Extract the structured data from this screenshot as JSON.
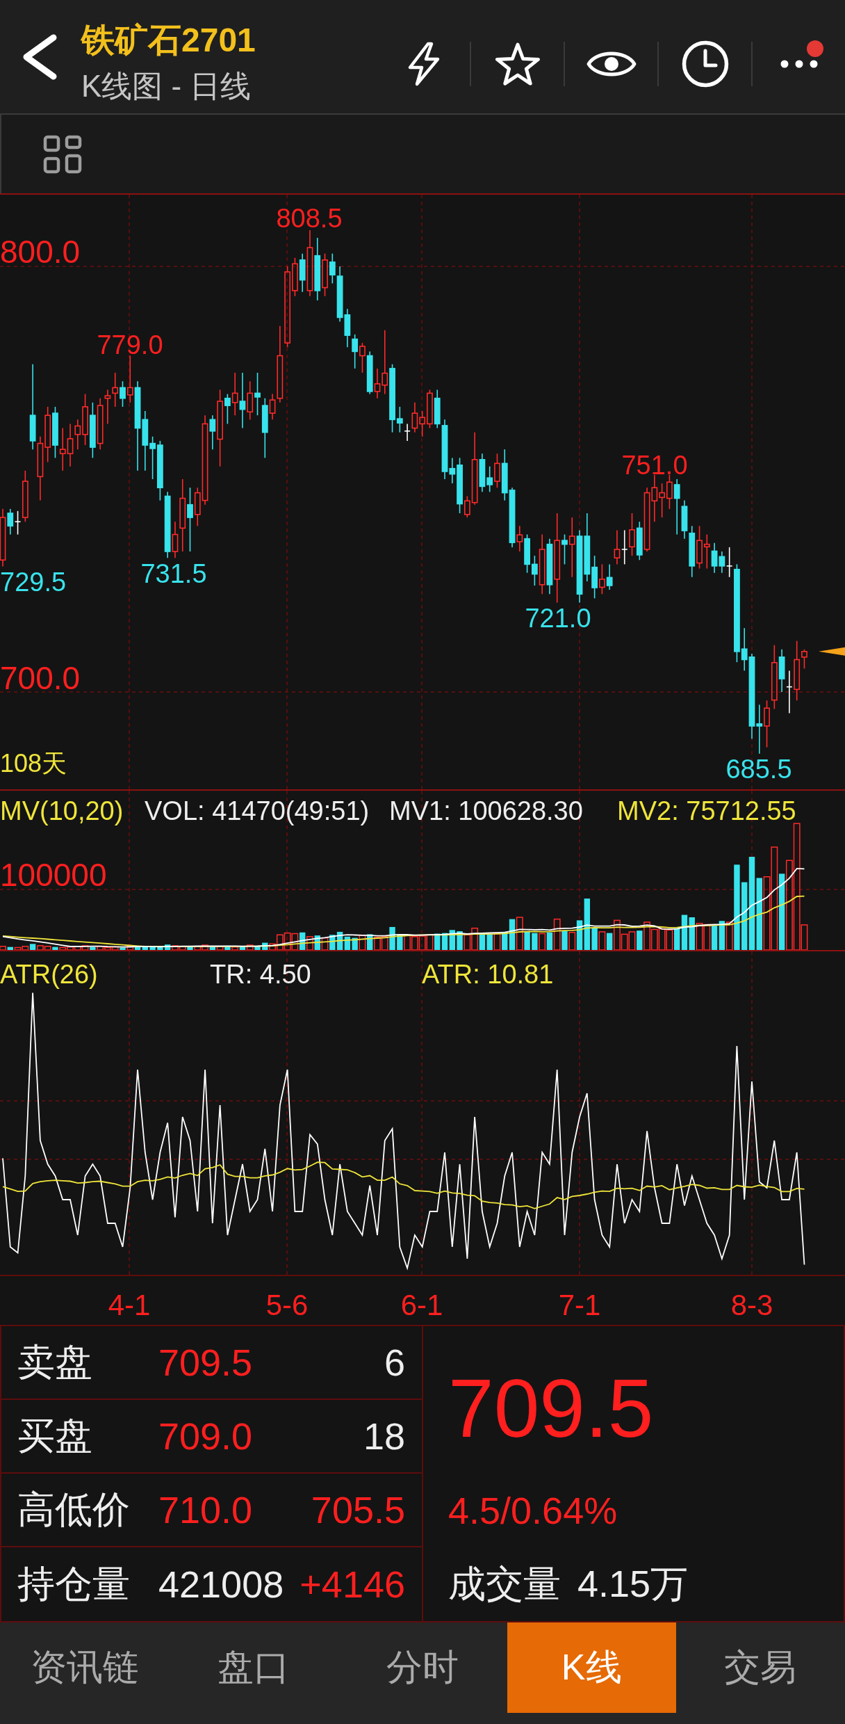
{
  "header": {
    "title": "铁矿石2701",
    "subtitle": "K线图 - 日线",
    "notification_dot": true
  },
  "price_chart": {
    "price_labels": [
      "800.0",
      "700.0"
    ],
    "extreme_labels": [
      {
        "text": "729.5",
        "kind": "low"
      },
      {
        "text": "779.0",
        "kind": "high"
      },
      {
        "text": "731.5",
        "kind": "low"
      },
      {
        "text": "808.5",
        "kind": "high"
      },
      {
        "text": "721.0",
        "kind": "low"
      },
      {
        "text": "751.0",
        "kind": "high"
      },
      {
        "text": "685.5",
        "kind": "low"
      }
    ],
    "day_count": "108天"
  },
  "volume_chart": {
    "legend": [
      {
        "text": "MV(10,20)",
        "kind": "title"
      },
      {
        "text": "VOL: 41470(49:51)",
        "kind": "vol"
      },
      {
        "text": "MV1: 100628.30",
        "kind": "mv1"
      },
      {
        "text": "MV2: 75712.55",
        "kind": "mv2"
      }
    ],
    "scale_label": "100000"
  },
  "atr_chart": {
    "legend": [
      {
        "text": "ATR(26)",
        "kind": "title"
      },
      {
        "text": "TR: 4.50",
        "kind": "tr"
      },
      {
        "text": "ATR: 10.81",
        "kind": "atr"
      }
    ]
  },
  "x_axis": [
    "4-1",
    "5-6",
    "6-1",
    "7-1",
    "8-3"
  ],
  "quote_table": {
    "rows": [
      {
        "label": "卖盘",
        "cells": [
          {
            "text": "709.5",
            "color": "#ff1f1f"
          },
          {
            "text": "6",
            "color": "#eeeeee"
          }
        ]
      },
      {
        "label": "买盘",
        "cells": [
          {
            "text": "709.0",
            "color": "#ff1f1f"
          },
          {
            "text": "18",
            "color": "#eeeeee"
          }
        ]
      },
      {
        "label": "高低价",
        "cells": [
          {
            "text": "710.0",
            "color": "#ff1f1f"
          },
          {
            "text": "705.5",
            "color": "#ff1f1f"
          }
        ]
      },
      {
        "label": "持仓量",
        "cells": [
          {
            "text": "421008",
            "color": "#eeeeee"
          },
          {
            "text": "+4146",
            "color": "#ff1f1f"
          }
        ]
      }
    ],
    "last_price": {
      "text": "709.5",
      "color": "#ff1f1f"
    },
    "change": {
      "text": "4.5/0.64%",
      "color": "#ff1f1f"
    },
    "turnover": {
      "label": "成交量",
      "value": "4.15万"
    }
  },
  "tabs": [
    {
      "label": "资讯链",
      "selected": false
    },
    {
      "label": "盘口",
      "selected": false
    },
    {
      "label": "分时",
      "selected": false
    },
    {
      "label": "K线",
      "selected": true
    },
    {
      "label": "交易",
      "selected": false
    }
  ]
}
